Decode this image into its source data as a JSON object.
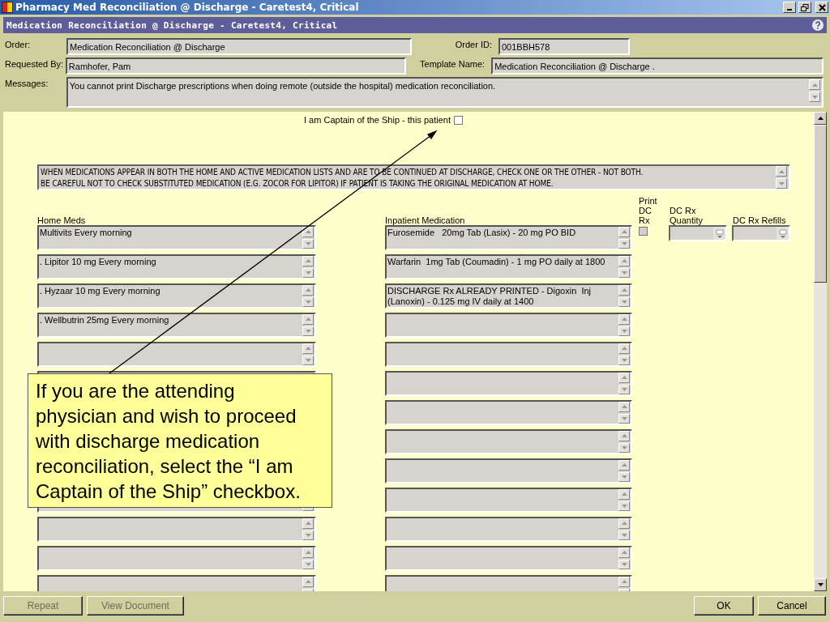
{
  "window": {
    "title": "Pharmacy Med Reconciliation @ Discharge - Caretest4, Critical"
  },
  "header": {
    "title": "Medication Reconciliation @ Discharge - Caretest4, Critical"
  },
  "form": {
    "order_label": "Order:",
    "order": "Medication Reconciliation @ Discharge",
    "order_id_label": "Order ID:",
    "order_id": "001BBH578",
    "requested_by_label": "Requested By:",
    "requested_by": "Ramhofer, Pam",
    "template_name_label": "Template Name:",
    "template_name": "Medication Reconciliation @ Discharge .",
    "messages_label": "Messages:",
    "messages": "You cannot print Discharge prescriptions when doing remote (outside the hospital) medication reconciliation."
  },
  "captain": {
    "label": "I am Captain of the Ship - this patient",
    "checked": false
  },
  "instructions": [
    "WHEN MEDICATIONS APPEAR IN BOTH THE HOME AND ACTIVE MEDICATION LISTS AND ARE TO BE CONTINUED AT DISCHARGE, CHECK ONE OR THE OTHER - NOT BOTH.",
    "BE CAREFUL NOT TO CHECK SUBSTITUTED MEDICATION (E.G. ZOCOR FOR LIPITOR) IF PATIENT IS TAKING THE ORIGINAL MEDICATION AT HOME."
  ],
  "columns": {
    "home": "Home Meds",
    "inpatient": "Inpatient Medication",
    "print": "Print DC Rx",
    "quantity": "DC Rx Quantity",
    "refills": "DC Rx Refills"
  },
  "print_dc_rx": {
    "checked": false,
    "disabled": true
  },
  "rows": [
    {
      "home": "Multivits Every morning",
      "inpatient": "Furosemide   20mg Tab (Lasix) - 20 mg PO BID"
    },
    {
      "home": ". Lipitor 10 mg Every morning",
      "inpatient": "Warfarin  1mg Tab (Coumadin) - 1 mg PO daily at 1800"
    },
    {
      "home": ". Hyzaar 10 mg Every morning",
      "inpatient": "DISCHARGE Rx ALREADY PRINTED - Digoxin  Inj (Lanoxin) - 0.125 mg IV daily at 1400"
    },
    {
      "home": ". Wellbutrin 25mg Every morning"
    },
    {},
    {},
    {},
    {},
    {},
    {},
    {},
    {},
    {}
  ],
  "left_buttons": [
    {
      "label": "Repeat",
      "disabled": true
    },
    {
      "label": "View Document",
      "disabled": true
    }
  ],
  "right_buttons": [
    {
      "label": "OK",
      "disabled": false
    },
    {
      "label": "Cancel",
      "disabled": false
    }
  ],
  "callout": {
    "text": "If you are the attending physician and wish to proceed with discharge medication reconciliation, select the “I am Captain of the Ship” checkbox."
  }
}
